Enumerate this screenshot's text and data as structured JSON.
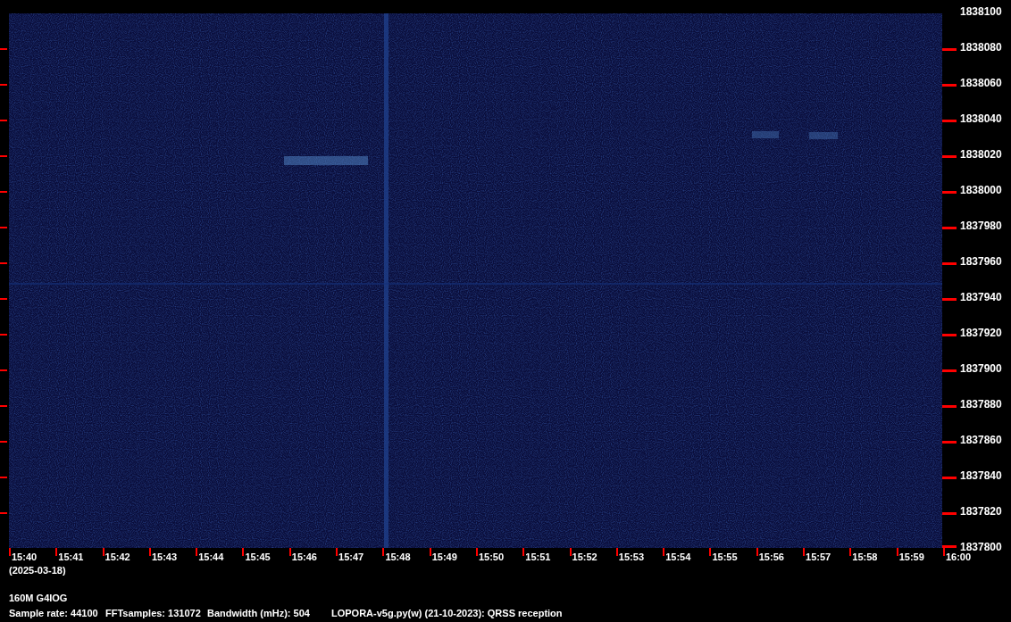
{
  "frequency_axis": {
    "labels": [
      "1838100",
      "1838080",
      "1838060",
      "1838040",
      "1838020",
      "1838000",
      "1837980",
      "1837960",
      "1837940",
      "1837920",
      "1837900",
      "1837880",
      "1837860",
      "1837840",
      "1837820",
      "1837800"
    ]
  },
  "time_axis": {
    "labels": [
      "15:40",
      "15:41",
      "15:42",
      "15:43",
      "15:44",
      "15:45",
      "15:46",
      "15:47",
      "15:48",
      "15:49",
      "15:50",
      "15:51",
      "15:52",
      "15:53",
      "15:54",
      "15:55",
      "15:56",
      "15:57",
      "15:58",
      "15:59",
      "16:00"
    ],
    "date": "(2025-03-18)"
  },
  "station": "160M G4IOG",
  "info": [
    "Sample rate: 44100",
    "FFTsamples: 131072",
    "Bandwidth (mHz): 504",
    "LOPORA-v5g.py(w) (21-10-2023): QRSS reception"
  ]
}
